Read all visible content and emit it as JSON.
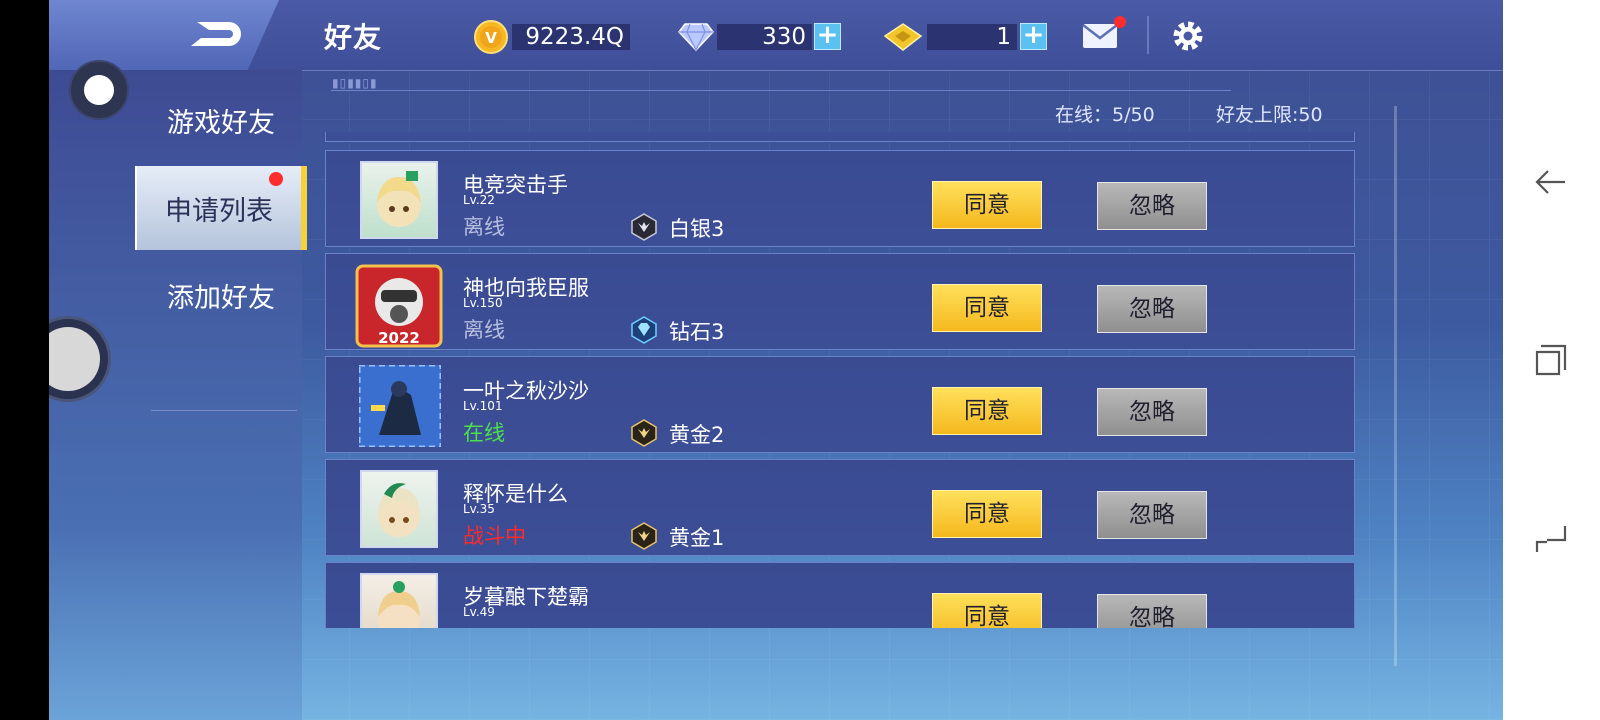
{
  "header": {
    "title": "好友",
    "gold": "9223.4Q",
    "diamonds": "330",
    "tickets": "1"
  },
  "sidebar": {
    "items": [
      {
        "label": "游戏好友"
      },
      {
        "label": "申请列表"
      },
      {
        "label": "添加好友"
      }
    ]
  },
  "stats": {
    "online": "在线：5/50",
    "limit": "好友上限:50"
  },
  "requests": [
    {
      "name": "电竞突击手",
      "level": "Lv.22",
      "status": "离线",
      "status_color": "#b7bedf",
      "rank": "白银3",
      "agree": "同意",
      "ignore": "忽略"
    },
    {
      "name": "神也向我臣服",
      "level": "Lv.150",
      "status": "离线",
      "status_color": "#b7bedf",
      "rank": "钻石3",
      "agree": "同意",
      "ignore": "忽略"
    },
    {
      "name": "一叶之秋沙沙",
      "level": "Lv.101",
      "status": "在线",
      "status_color": "#4be04b",
      "rank": "黄金2",
      "agree": "同意",
      "ignore": "忽略"
    },
    {
      "name": "释怀是什么",
      "level": "Lv.35",
      "status": "战斗中",
      "status_color": "#ff2b2b",
      "rank": "黄金1",
      "agree": "同意",
      "ignore": "忽略"
    },
    {
      "name": "岁暮酿下楚霸",
      "level": "Lv.49",
      "status": "",
      "status_color": "#b7bedf",
      "rank": "",
      "agree": "同意",
      "ignore": "忽略"
    }
  ]
}
